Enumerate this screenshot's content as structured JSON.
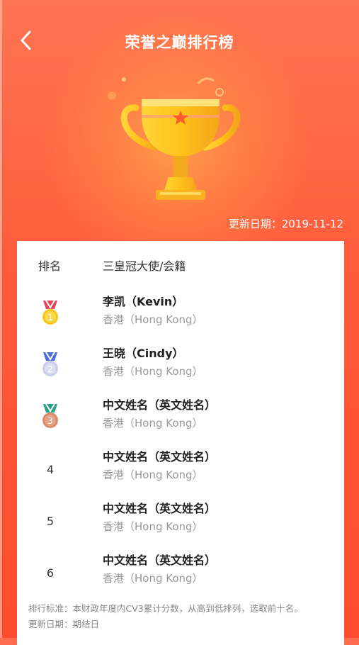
{
  "header": {
    "title": "荣誉之巅排行榜",
    "update_date": "更新日期：2019-11-12"
  },
  "table": {
    "col_rank": "排名",
    "col_name": "三皇冠大使/会籍",
    "rows": [
      {
        "rank": "1",
        "name": "李凯（Kevin）",
        "region": "香港（Hong Kong）",
        "medal": "gold"
      },
      {
        "rank": "2",
        "name": "王晓（Cindy）",
        "region": "香港（Hong Kong）",
        "medal": "silver"
      },
      {
        "rank": "3",
        "name": "中文姓名（英文姓名）",
        "region": "香港（Hong Kong）",
        "medal": "bronze"
      },
      {
        "rank": "4",
        "name": "中文姓名（英文姓名）",
        "region": "香港（Hong Kong）"
      },
      {
        "rank": "5",
        "name": "中文姓名（英文姓名）",
        "region": "香港（Hong Kong）"
      },
      {
        "rank": "6",
        "name": "中文姓名（英文姓名）",
        "region": "香港（Hong Kong）"
      }
    ]
  },
  "footer": {
    "criteria": "排行标准：本财政年度内CV3累计分数，从高到低排列，选取前十名。",
    "update": "更新日期：期结日"
  },
  "colors": {
    "accent": "#ff5a3c",
    "gold": "#f5c518",
    "silver": "#c9cde8",
    "bronze": "#d98b6a"
  },
  "icons": {
    "back": "chevron-left-icon",
    "trophy": "trophy-icon",
    "medal": "medal-icon"
  }
}
